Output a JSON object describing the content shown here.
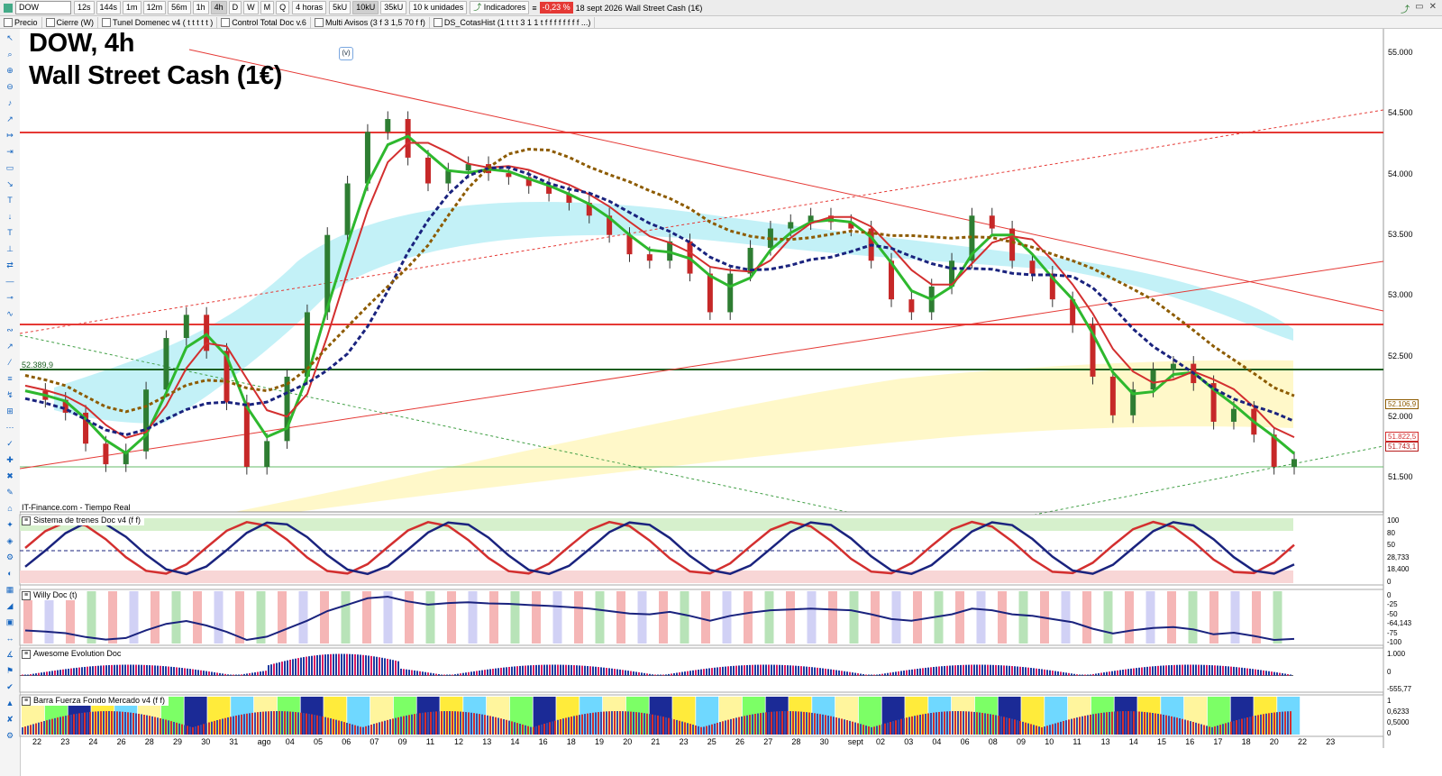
{
  "toolbar": {
    "symbol": "DOW",
    "timeframes": [
      "12s",
      "144s",
      "1m",
      "12m",
      "56m",
      "1h",
      "4h",
      "D",
      "W",
      "M",
      "Q"
    ],
    "active_timeframe": "4h",
    "period_select": "4 horas",
    "units": [
      "5kU",
      "10kU",
      "35kU"
    ],
    "active_unit": "10kU",
    "unit_select": "10 k unidades",
    "indicators_label": "Indicadores",
    "change_badge": "-0,23 %",
    "date_text": "18 sept 2026",
    "instrument_text": "Wall Street Cash (1€)"
  },
  "indicator_bar": [
    "Precio",
    "Cierre (W)",
    "Tunel Domenec v4 ( t t t t t )",
    "Control Total Doc v.6",
    "Multi Avisos (3 f 3 1,5 70 f f)",
    "DS_CotasHist (1 t t t 3 1 1 t f f f f f f f f ...)"
  ],
  "chart": {
    "title_line1": "DOW, 4h",
    "title_line2": "Wall Street Cash (1€)",
    "badge": "(v)",
    "source": "IT-Finance.com - Tiempo Real",
    "support_label": "52.389,9",
    "price_axis": [
      "55.000",
      "54.500",
      "54.000",
      "53.500",
      "53.000",
      "52.500",
      "52.000",
      "51.500"
    ],
    "price_tags": [
      {
        "text": "52.106,9",
        "color": "#8d5b00"
      },
      {
        "text": "51.822,5",
        "color": "#d32f2f"
      },
      {
        "text": "51.743,1",
        "color": "#b71c1c"
      }
    ]
  },
  "panels": [
    {
      "title": "Sistema de trenes Doc v4 (f f)",
      "axis": [
        "100",
        "80",
        "50",
        "28,733",
        "18,400",
        "0"
      ]
    },
    {
      "title": "Willy Doc (t)",
      "axis": [
        "0",
        "-25",
        "-50",
        "-64,143",
        "-75",
        "-100"
      ]
    },
    {
      "title": "Awesome Evolution Doc",
      "axis": [
        "1.000",
        "0",
        "-555,77"
      ]
    },
    {
      "title": "Barra Fuerza Fondo Mercado v4 (f f)",
      "axis": [
        "1",
        "0,6233",
        "0,5000",
        "0"
      ]
    }
  ],
  "date_axis": [
    "22",
    "23",
    "24",
    "26",
    "28",
    "29",
    "30",
    "31",
    "ago",
    "04",
    "05",
    "06",
    "07",
    "09",
    "11",
    "12",
    "13",
    "14",
    "16",
    "18",
    "19",
    "20",
    "21",
    "23",
    "25",
    "26",
    "27",
    "28",
    "30",
    "sept",
    "02",
    "03",
    "04",
    "06",
    "08",
    "09",
    "10",
    "11",
    "13",
    "14",
    "15",
    "16",
    "17",
    "18",
    "20",
    "22",
    "23"
  ],
  "chart_data": {
    "type": "line",
    "title": "DOW, 4h",
    "ylim": [
      51350,
      55100
    ],
    "series": [
      {
        "name": "Close",
        "values": [
          52290,
          52220,
          52120,
          51880,
          51720,
          51820,
          52300,
          52700,
          52880,
          52600,
          52200,
          51700,
          51900,
          52400,
          52900,
          53500,
          53900,
          54300,
          54400,
          54100,
          53900,
          54000,
          54050,
          53980,
          53950,
          53880,
          53820,
          53750,
          53650,
          53500,
          53350,
          53300,
          53450,
          53200,
          52900,
          53200,
          53400,
          53550,
          53600,
          53650,
          53600,
          53550,
          53300,
          53000,
          52900,
          53100,
          53300,
          53650,
          53550,
          53300,
          53200,
          53000,
          52800,
          52400,
          52100,
          52300,
          52450,
          52500,
          52350,
          52050,
          52150,
          51950,
          51700,
          51760
        ]
      }
    ],
    "levels": [
      54350,
      52750,
      52390,
      51600
    ],
    "grid": false
  }
}
